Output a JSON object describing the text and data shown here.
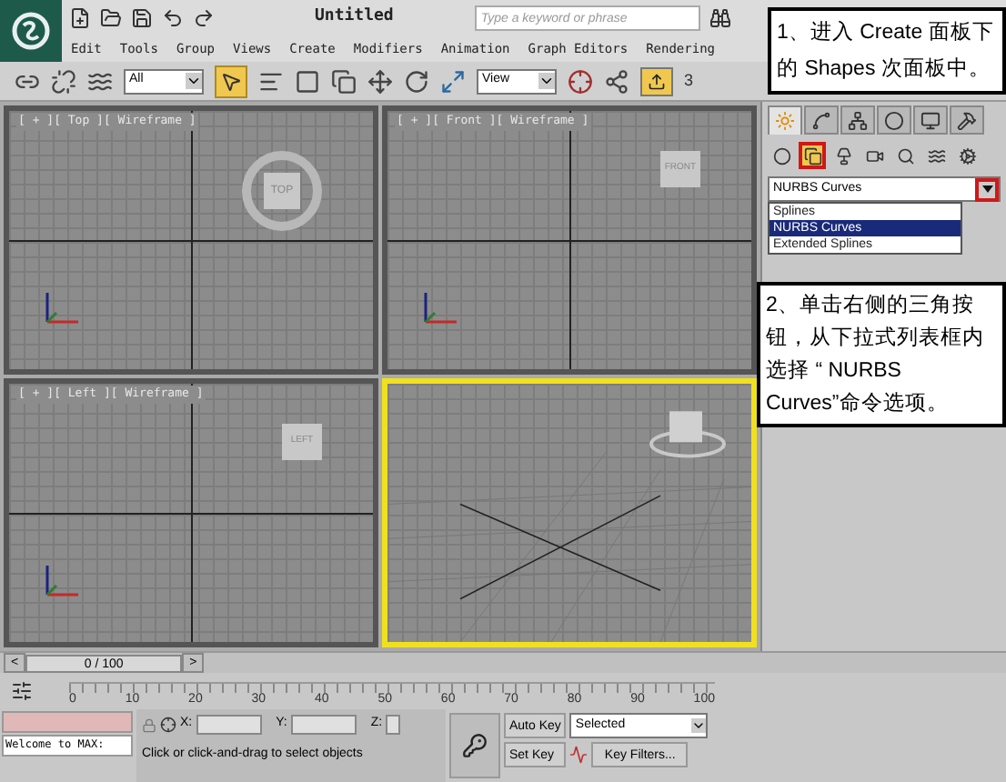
{
  "title_bar": {
    "title": "Untitled",
    "search": {
      "placeholder": "Type a keyword or phrase"
    }
  },
  "menu": [
    "Edit",
    "Tools",
    "Group",
    "Views",
    "Create",
    "Modifiers",
    "Animation",
    "Graph Editors",
    "Rendering"
  ],
  "toolbar": {
    "selection_filter": "All",
    "coordinate_system": "View",
    "select_object_active": true,
    "snap_number": "3"
  },
  "viewports": [
    {
      "label": "[ + ][ Top ][ Wireframe ]",
      "kind": "top",
      "cube": "TOP",
      "active": false
    },
    {
      "label": "[ + ][ Front ][ Wireframe ]",
      "kind": "front",
      "cube": "FRONT",
      "active": false
    },
    {
      "label": "[ + ][ Left ][ Wireframe ]",
      "kind": "left",
      "cube": "LEFT",
      "active": false
    },
    {
      "kind": "perspective",
      "active": true
    }
  ],
  "command_panel": {
    "tabs": [
      {
        "kind": "create",
        "selected": true
      },
      {
        "kind": "modify",
        "selected": false
      },
      {
        "kind": "hierarchy",
        "selected": false
      },
      {
        "kind": "motion",
        "selected": false
      },
      {
        "kind": "display",
        "selected": false
      },
      {
        "kind": "utilities",
        "selected": false
      }
    ],
    "subcategories": [
      {
        "kind": "geometry",
        "selected": false
      },
      {
        "kind": "shapes",
        "selected": true
      },
      {
        "kind": "lights",
        "selected": false
      },
      {
        "kind": "cameras",
        "selected": false
      },
      {
        "kind": "helpers",
        "selected": false
      },
      {
        "kind": "spacewarps",
        "selected": false
      },
      {
        "kind": "systems",
        "selected": false
      }
    ],
    "category": {
      "value": "NURBS Curves",
      "options": [
        {
          "label": "Splines",
          "selected": false
        },
        {
          "label": "NURBS Curves",
          "selected": true
        },
        {
          "label": "Extended Splines",
          "selected": false
        }
      ]
    }
  },
  "time_slider": {
    "prev": "<",
    "position": "0 / 100",
    "next": ">"
  },
  "timeline": {
    "ticks": [
      "0",
      "10",
      "20",
      "30",
      "40",
      "50",
      "60",
      "70",
      "80",
      "90",
      "100"
    ]
  },
  "status": {
    "listener": "Welcome to MAX:",
    "prompt": "Click or click-and-drag to select objects",
    "x_label": "X:",
    "y_label": "Y:",
    "z_label": "Z:",
    "auto_key": "Auto Key",
    "key_mode": "Selected",
    "set_key": "Set Key",
    "key_filters": "Key Filters..."
  },
  "callouts": [
    {
      "text": "1、进入 Create 面板下的 Shapes 次面板中。"
    },
    {
      "text": "2、单击右侧的三角按钮，从下拉式列表框内选择 “ NURBS Curves”命令选项。"
    }
  ]
}
